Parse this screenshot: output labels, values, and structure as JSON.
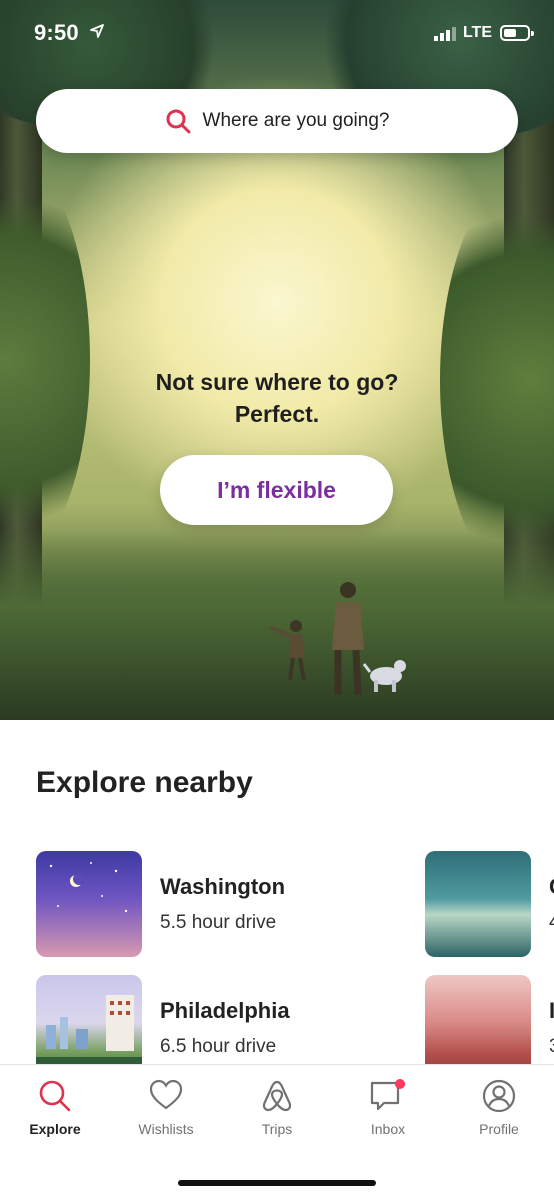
{
  "status_bar": {
    "time": "9:50",
    "network": "LTE"
  },
  "search": {
    "placeholder_text": "Where are you going?"
  },
  "hero": {
    "line1": "Not sure where to go?",
    "line2": "Perfect.",
    "button_label": "I’m flexible"
  },
  "explore": {
    "title": "Explore nearby",
    "items": [
      {
        "name": "Washington",
        "drive": "5.5 hour drive"
      },
      {
        "name": "Philadelphia",
        "drive": "6.5 hour drive"
      }
    ],
    "partial_items": [
      {
        "name": "C",
        "drive": "4"
      },
      {
        "name": "I",
        "drive": "3"
      }
    ]
  },
  "tabs": [
    {
      "label": "Explore",
      "icon": "search-icon",
      "active": true
    },
    {
      "label": "Wishlists",
      "icon": "heart-icon",
      "active": false
    },
    {
      "label": "Trips",
      "icon": "airbnb-logo-icon",
      "active": false
    },
    {
      "label": "Inbox",
      "icon": "message-icon",
      "active": false,
      "badge": true
    },
    {
      "label": "Profile",
      "icon": "profile-icon",
      "active": false
    }
  ],
  "colors": {
    "accent": "#e0314f",
    "flexible_text": "#7a2ea0",
    "badge": "#ff385c"
  }
}
